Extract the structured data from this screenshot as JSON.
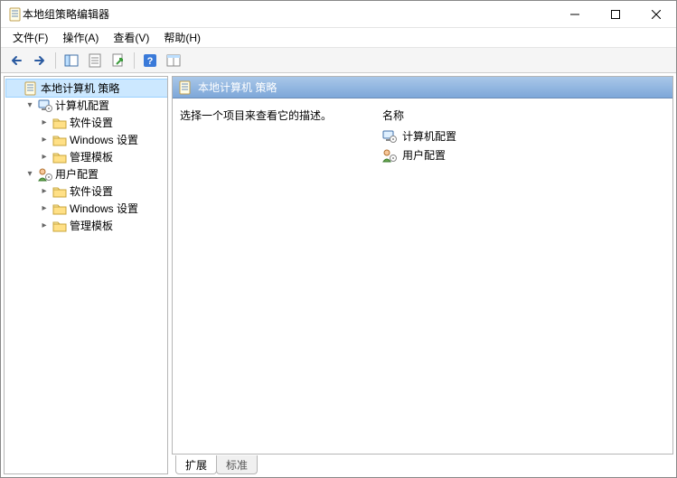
{
  "window": {
    "title": "本地组策略编辑器"
  },
  "menu": {
    "file": "文件(F)",
    "action": "操作(A)",
    "view": "查看(V)",
    "help": "帮助(H)"
  },
  "tree": {
    "root": "本地计算机 策略",
    "computer": "计算机配置",
    "user": "用户配置",
    "software": "软件设置",
    "windows": "Windows 设置",
    "templates": "管理模板"
  },
  "content": {
    "header": "本地计算机 策略",
    "description": "选择一个项目来查看它的描述。",
    "col_name": "名称",
    "item_computer": "计算机配置",
    "item_user": "用户配置"
  },
  "tabs": {
    "extended": "扩展",
    "standard": "标准"
  }
}
